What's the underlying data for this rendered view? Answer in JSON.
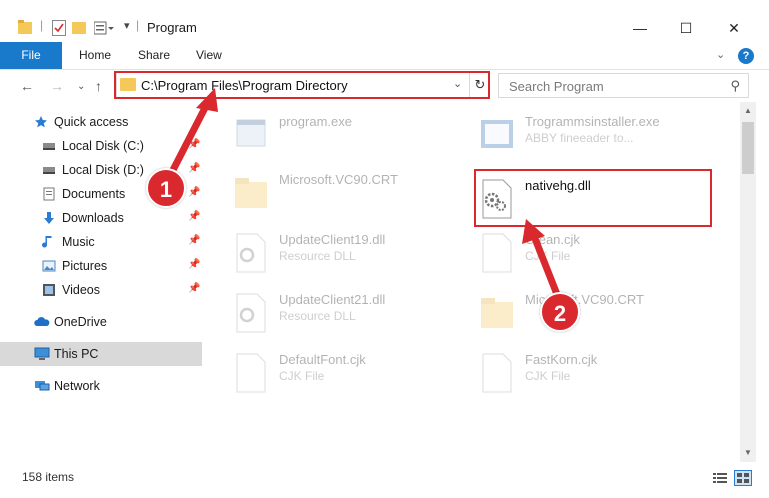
{
  "window": {
    "title": "Program",
    "controls": {
      "minimize": "—",
      "maximize": "☐",
      "close": "✕"
    }
  },
  "ribbon": {
    "tabs": [
      "File",
      "Home",
      "Share",
      "View"
    ],
    "help": "?"
  },
  "address": {
    "path": "C:\\Program Files\\Program Directory",
    "search_placeholder": "Search Program"
  },
  "sidebar": {
    "items": [
      {
        "label": "Quick access",
        "icon": "star-icon",
        "pinned": false
      },
      {
        "label": "Local Disk (C:)",
        "icon": "drive-icon",
        "pinned": true
      },
      {
        "label": "Local Disk (D:)",
        "icon": "drive-icon",
        "pinned": true
      },
      {
        "label": "Documents",
        "icon": "documents-icon",
        "pinned": true
      },
      {
        "label": "Downloads",
        "icon": "download-icon",
        "pinned": true
      },
      {
        "label": "Music",
        "icon": "music-icon",
        "pinned": true
      },
      {
        "label": "Pictures",
        "icon": "pictures-icon",
        "pinned": true
      },
      {
        "label": "Videos",
        "icon": "videos-icon",
        "pinned": true
      },
      {
        "label": "OneDrive",
        "icon": "cloud-icon",
        "pinned": false
      },
      {
        "label": "This PC",
        "icon": "computer-icon",
        "pinned": false,
        "selected": true
      },
      {
        "label": "Network",
        "icon": "network-icon",
        "pinned": false
      }
    ]
  },
  "files": [
    {
      "name": "program.exe",
      "sub": "",
      "icon": "exe-icon"
    },
    {
      "name": "Trogrammsinstaller.exe",
      "sub": "ABBY fineeader to...",
      "icon": "installer-icon"
    },
    {
      "name": "Microsoft.VC90.CRT",
      "sub": "",
      "icon": "folder-icon"
    },
    {
      "name": "nativehg.dll",
      "sub": "",
      "icon": "dll-icon",
      "active": true
    },
    {
      "name": "UpdateClient19.dll",
      "sub": "Resource DLL",
      "icon": "dll-icon"
    },
    {
      "name": "Crean.cjk",
      "sub": "CJK File",
      "icon": "file-icon"
    },
    {
      "name": "UpdateClient21.dll",
      "sub": "Resource DLL",
      "icon": "dll-icon"
    },
    {
      "name": "Microsoft.VC90.CRT",
      "sub": "",
      "icon": "folder-icon"
    },
    {
      "name": "DefaultFont.cjk",
      "sub": "CJK File",
      "icon": "file-icon"
    },
    {
      "name": "FastKorn.cjk",
      "sub": "CJK File",
      "icon": "file-icon"
    }
  ],
  "status": {
    "item_count": "158 items"
  },
  "annotations": {
    "step1": "1",
    "step2": "2",
    "accent": "#d9282e"
  }
}
